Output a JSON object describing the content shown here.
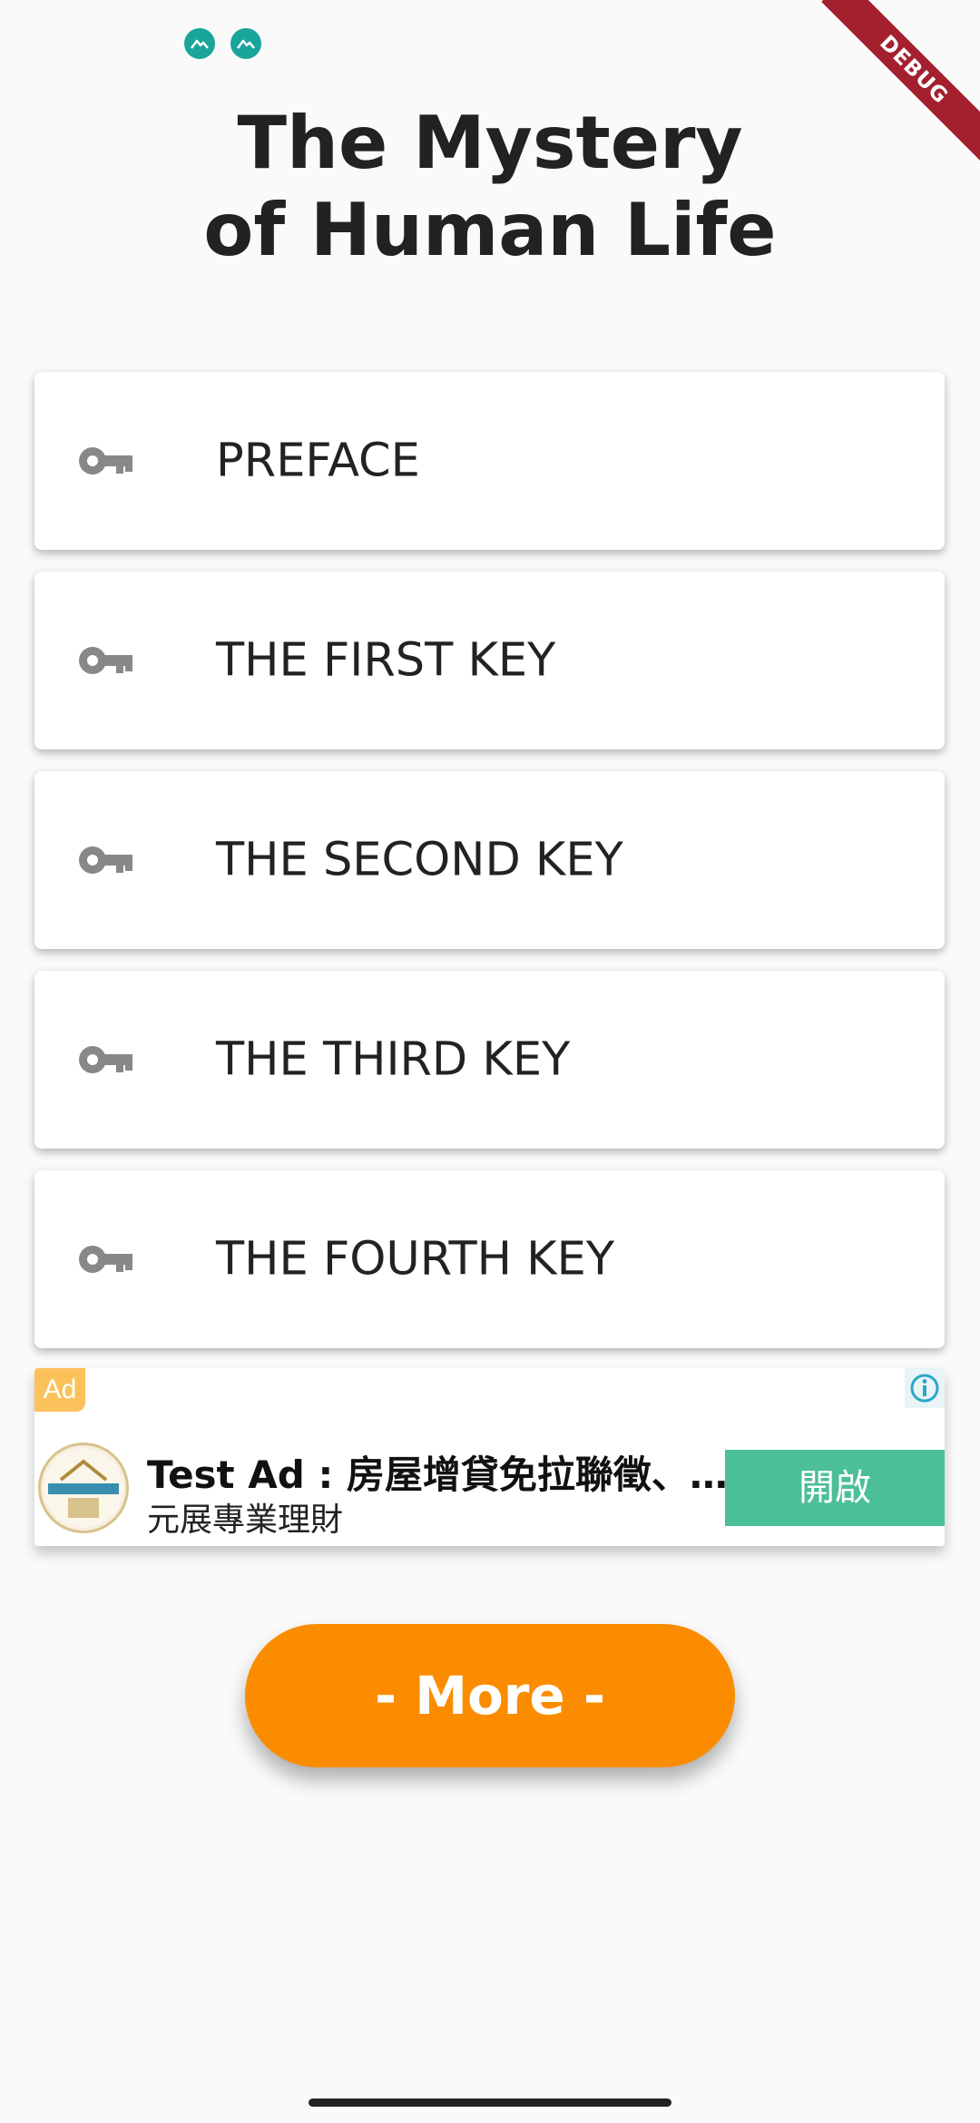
{
  "status_bar": {
    "icons": [
      "teal-notification-icon",
      "teal-notification-icon"
    ]
  },
  "debug_banner": "DEBUG",
  "title": {
    "line1": "The Mystery",
    "line2": "of Human Life"
  },
  "menu": {
    "items": [
      {
        "label": "PREFACE",
        "icon": "key-icon"
      },
      {
        "label": "THE FIRST KEY",
        "icon": "key-icon"
      },
      {
        "label": "THE SECOND KEY",
        "icon": "key-icon"
      },
      {
        "label": "THE THIRD KEY",
        "icon": "key-icon"
      },
      {
        "label": "THE FOURTH KEY",
        "icon": "key-icon"
      }
    ]
  },
  "ad": {
    "badge": "Ad",
    "title": "Test Ad : 房屋增貸免拉聯徵、…",
    "advertiser": "元展專業理財",
    "cta": "開啟",
    "colors": {
      "badge": "#fbc25c",
      "cta": "#4bbf98"
    }
  },
  "more_button": {
    "label": "- More -",
    "color": "#fb8c00"
  }
}
